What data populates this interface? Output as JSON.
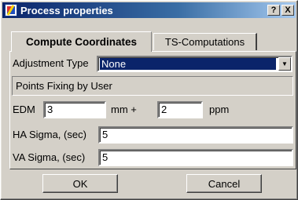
{
  "window": {
    "title": "Process properties",
    "help_label": "?",
    "close_label": "X",
    "icon": "app-icon"
  },
  "tabs": [
    {
      "label": "Compute Coordinates",
      "active": true
    },
    {
      "label": "TS-Computations",
      "active": false
    }
  ],
  "form": {
    "adjustment_type_label": "Adjustment Type",
    "adjustment_type_value": "None",
    "fixing_note": "Points Fixing by User",
    "edm_label": "EDM",
    "edm_mm_value": "3",
    "mm_plus_label": "mm +",
    "edm_ppm_value": "2",
    "ppm_label": "ppm",
    "ha_sigma_label": "HA Sigma, (sec)",
    "ha_sigma_value": "5",
    "va_sigma_label": "VA Sigma, (sec)",
    "va_sigma_value": "5"
  },
  "buttons": {
    "ok": "OK",
    "cancel": "Cancel"
  }
}
